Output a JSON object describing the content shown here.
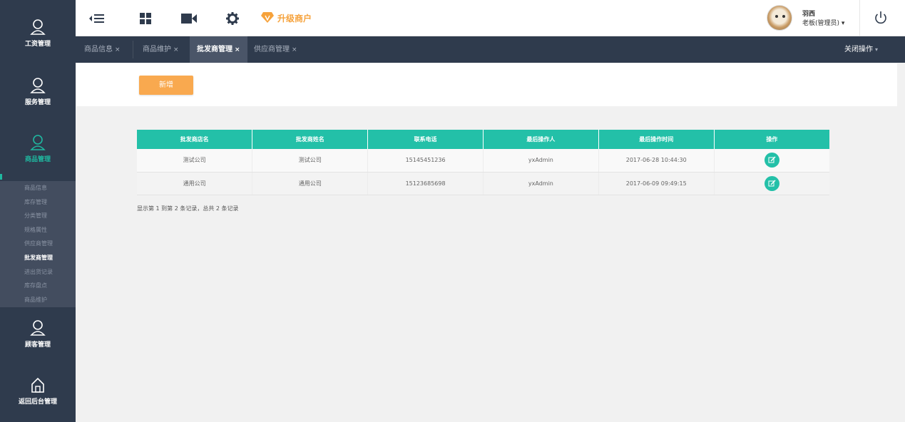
{
  "sidebar": {
    "nav": [
      {
        "label": "工资管理",
        "icon": "user-icon"
      },
      {
        "label": "服务管理",
        "icon": "user-icon"
      },
      {
        "label": "商品管理",
        "icon": "user-icon",
        "active": true
      },
      {
        "label": "顾客管理",
        "icon": "user-icon"
      },
      {
        "label": "返回后台管理",
        "icon": "home-icon"
      }
    ],
    "submenu": [
      "商品信息",
      "库存管理",
      "分类管理",
      "规格属性",
      "供应商管理",
      "批发商管理",
      "进出货记录",
      "库存盘点",
      "商品维护"
    ],
    "submenu_active": "批发商管理"
  },
  "header": {
    "icons": [
      "menu-toggle-icon",
      "grid-icon",
      "video-icon",
      "settings-icon"
    ],
    "upgrade_label": "升级商户",
    "user_name": "羽西",
    "user_role": "老板(管理员)",
    "accent": "#f6a23b"
  },
  "tabs": [
    {
      "label": "商品信息",
      "close": "×"
    },
    {
      "label": "商品维护",
      "close": "×"
    },
    {
      "label": "批发商管理",
      "close": "×",
      "active": true
    },
    {
      "label": "供应商管理",
      "close": "×"
    }
  ],
  "close_ops_label": "关闭操作",
  "toolbar": {
    "add_label": "新增"
  },
  "table": {
    "headers": [
      "批发商店名",
      "批发商姓名",
      "联系电话",
      "最后操作人",
      "最后操作时间",
      "操作"
    ],
    "rows": [
      [
        "测试公司",
        "测试公司",
        "15145451236",
        "yxAdmin",
        "2017-06-28 10:44:30"
      ],
      [
        "通用公司",
        "通用公司",
        "15123685698",
        "yxAdmin",
        "2017-06-09 09:49:15"
      ]
    ]
  },
  "pager_info": "显示第 1 到第 2 条记录，总共 2 条记录",
  "colors": {
    "sidebar": "#2f3b4d",
    "teal": "#23c0a8",
    "orange": "#f9a94f"
  }
}
